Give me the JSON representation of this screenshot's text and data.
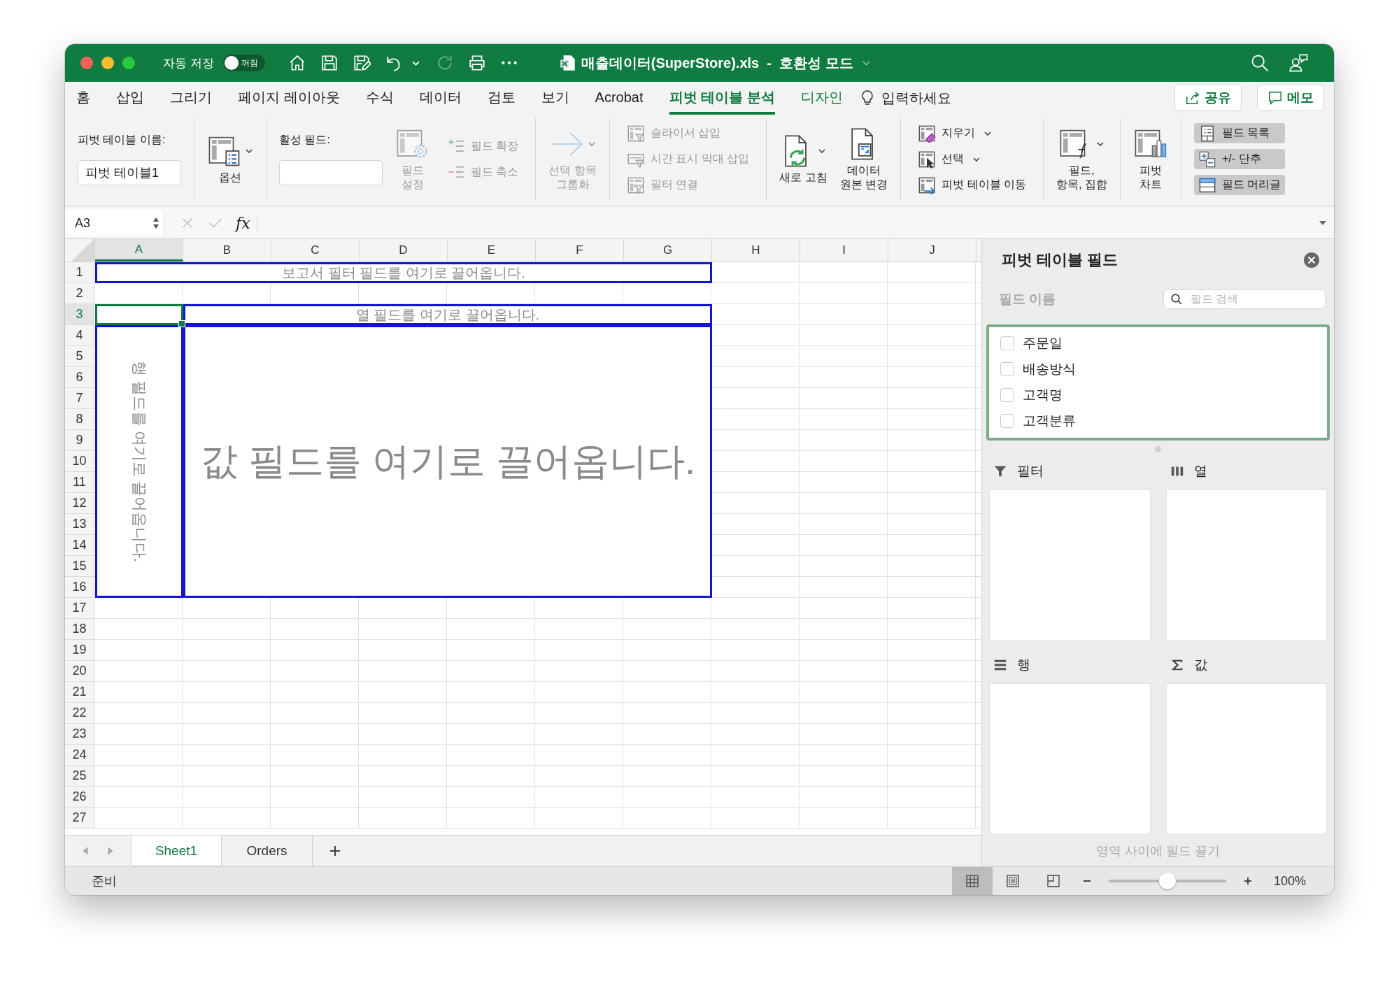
{
  "window": {
    "title": "매출데이터(SuperStore).xls  -  호환성 모드"
  },
  "autosave": {
    "label": "자동 저장",
    "on": false,
    "state_label": "꺼짐"
  },
  "tabs": [
    {
      "label": "홈",
      "selected": false,
      "contextual": false
    },
    {
      "label": "삽입",
      "selected": false,
      "contextual": false
    },
    {
      "label": "그리기",
      "selected": false,
      "contextual": false
    },
    {
      "label": "페이지 레이아웃",
      "selected": false,
      "contextual": false
    },
    {
      "label": "수식",
      "selected": false,
      "contextual": false
    },
    {
      "label": "데이터",
      "selected": false,
      "contextual": false
    },
    {
      "label": "검토",
      "selected": false,
      "contextual": false
    },
    {
      "label": "보기",
      "selected": false,
      "contextual": false
    },
    {
      "label": "Acrobat",
      "selected": false,
      "contextual": false
    },
    {
      "label": "피벗 테이블 분석",
      "selected": true,
      "contextual": true
    },
    {
      "label": "디자인",
      "selected": false,
      "contextual": true
    }
  ],
  "tell_me": {
    "label": "입력하세요"
  },
  "share_button": {
    "label": "공유"
  },
  "comment_button": {
    "label": "메모"
  },
  "ribbon": {
    "groups": [
      {
        "columns": [
          {
            "kind": "field",
            "label": "피벗 테이블 이름:",
            "value": "피벗 테이블1"
          }
        ]
      },
      {
        "columns": [
          {
            "kind": "large",
            "lines": [
              "옵션"
            ],
            "disabled": false,
            "dropdown": true
          }
        ]
      },
      {
        "columns": [
          {
            "kind": "field",
            "label": "활성 필드:"
          },
          {
            "kind": "large",
            "lines": [
              "필드",
              "설정"
            ],
            "disabled": true,
            "dropdown": false
          },
          {
            "kind": "stack",
            "items": [
              {
                "label": "필드 확장",
                "disabled": true,
                "dropdown": false
              },
              {
                "label": "필드 축소",
                "disabled": true,
                "dropdown": false
              }
            ]
          }
        ]
      },
      {
        "columns": [
          {
            "kind": "large",
            "lines": [
              "선택 항목",
              "그룹화"
            ],
            "disabled": true,
            "dropdown": true
          }
        ]
      },
      {
        "columns": [
          {
            "kind": "stack",
            "items": [
              {
                "label": "슬라이서 삽입",
                "disabled": true,
                "dropdown": false
              },
              {
                "label": "시간 표시 막대 삽입",
                "disabled": true,
                "dropdown": false
              },
              {
                "label": "필터 연결",
                "disabled": true,
                "dropdown": false
              }
            ]
          }
        ]
      },
      {
        "columns": [
          {
            "kind": "large",
            "lines": [
              "새로 고침"
            ],
            "disabled": false,
            "dropdown": true
          },
          {
            "kind": "large",
            "lines": [
              "데이터",
              "원본 변경"
            ],
            "disabled": false,
            "dropdown": false
          }
        ]
      },
      {
        "columns": [
          {
            "kind": "stack",
            "items": [
              {
                "label": "지우기",
                "disabled": false,
                "dropdown": true
              },
              {
                "label": "선택",
                "disabled": false,
                "dropdown": true
              },
              {
                "label": "피벗 테이블 이동",
                "disabled": false,
                "dropdown": false
              }
            ]
          }
        ]
      },
      {
        "columns": [
          {
            "kind": "large",
            "lines": [
              "필드,",
              "항목, 집합"
            ],
            "disabled": false,
            "dropdown": true
          }
        ]
      },
      {
        "columns": [
          {
            "kind": "large",
            "lines": [
              "피벗",
              "차트"
            ],
            "disabled": false,
            "dropdown": false
          }
        ]
      },
      {
        "columns": [
          {
            "kind": "toggles",
            "items": [
              {
                "label": "필드 목록",
                "on": true
              },
              {
                "label": "+/- 단추",
                "on": true
              },
              {
                "label": "필드 머리글",
                "on": true
              }
            ]
          }
        ]
      }
    ]
  },
  "formula_bar": {
    "name_box": "A3",
    "function_label": "fx"
  },
  "sheet": {
    "columns": [
      {
        "label": "A",
        "selected": true
      },
      {
        "label": "B",
        "selected": false
      },
      {
        "label": "C",
        "selected": false
      },
      {
        "label": "D",
        "selected": false
      },
      {
        "label": "E",
        "selected": false
      },
      {
        "label": "F",
        "selected": false
      },
      {
        "label": "G",
        "selected": false
      },
      {
        "label": "H",
        "selected": false
      },
      {
        "label": "I",
        "selected": false
      },
      {
        "label": "J",
        "selected": false
      }
    ],
    "rows": [
      {
        "label": "1",
        "selected": false
      },
      {
        "label": "2",
        "selected": false
      },
      {
        "label": "3",
        "selected": true
      },
      {
        "label": "4",
        "selected": false
      },
      {
        "label": "5",
        "selected": false
      },
      {
        "label": "6",
        "selected": false
      },
      {
        "label": "7",
        "selected": false
      },
      {
        "label": "8",
        "selected": false
      },
      {
        "label": "9",
        "selected": false
      },
      {
        "label": "10",
        "selected": false
      },
      {
        "label": "11",
        "selected": false
      },
      {
        "label": "12",
        "selected": false
      },
      {
        "label": "13",
        "selected": false
      },
      {
        "label": "14",
        "selected": false
      },
      {
        "label": "15",
        "selected": false
      },
      {
        "label": "16",
        "selected": false
      },
      {
        "label": "17",
        "selected": false
      },
      {
        "label": "18",
        "selected": false
      },
      {
        "label": "19",
        "selected": false
      },
      {
        "label": "20",
        "selected": false
      },
      {
        "label": "21",
        "selected": false
      },
      {
        "label": "22",
        "selected": false
      },
      {
        "label": "23",
        "selected": false
      },
      {
        "label": "24",
        "selected": false
      },
      {
        "label": "25",
        "selected": false
      },
      {
        "label": "26",
        "selected": false
      },
      {
        "label": "27",
        "selected": false
      }
    ],
    "pivot": {
      "filter_hint": "보고서 필터 필드를 여기로 끌어옵니다.",
      "column_hint": "열 필드를 여기로 끌어옵니다.",
      "row_hint": "행 필드를 여기로 끌어옵니다.",
      "value_hint": "값 필드를 여기로 끌어옵니다."
    }
  },
  "field_panel": {
    "title": "피벗 테이블 필드",
    "name_label": "필드 이름",
    "search": {
      "placeholder": "필드 검색"
    },
    "fields": [
      {
        "name": "주문일",
        "checked": false
      },
      {
        "name": "배송방식",
        "checked": false
      },
      {
        "name": "고객명",
        "checked": false
      },
      {
        "name": "고객분류",
        "checked": false
      }
    ],
    "areas": [
      {
        "kind": "filter",
        "label": "필터"
      },
      {
        "kind": "columns",
        "label": "열"
      },
      {
        "kind": "rows",
        "label": "행"
      },
      {
        "kind": "values",
        "label": "값"
      }
    ],
    "hint": "영역 사이에 필드 끌기"
  },
  "sheet_tabs": [
    {
      "label": "Sheet1",
      "selected": true
    },
    {
      "label": "Orders",
      "selected": false
    }
  ],
  "status_bar": {
    "status": "준비",
    "views": [
      {
        "kind": "normal",
        "selected": true
      },
      {
        "kind": "page-layout",
        "selected": false
      },
      {
        "kind": "page-break",
        "selected": false
      }
    ],
    "zoom": {
      "level": 0.5,
      "reading": "100%"
    }
  }
}
